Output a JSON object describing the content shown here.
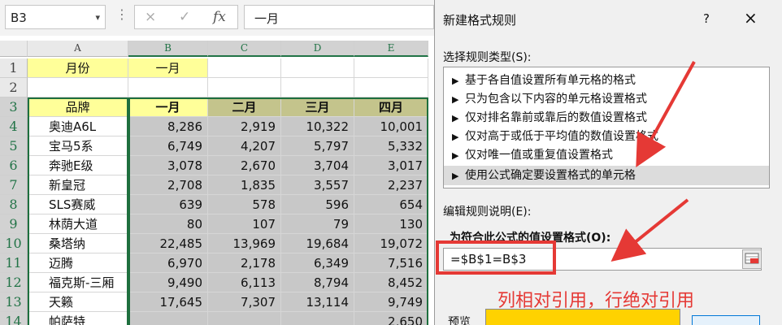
{
  "formula_bar": {
    "name_box": "B3",
    "cancel_icon": "×",
    "enter_icon": "✓",
    "fx_label": "fx",
    "formula": "一月"
  },
  "sheet": {
    "columns": [
      "A",
      "B",
      "C",
      "D",
      "E"
    ],
    "row_numbers": [
      "1",
      "2",
      "3",
      "4",
      "5",
      "6",
      "7",
      "8",
      "9",
      "10",
      "11",
      "12",
      "13",
      "14"
    ],
    "row1": {
      "a": "月份",
      "b": "一月"
    },
    "headers": [
      "品牌",
      "一月",
      "二月",
      "三月",
      "四月"
    ],
    "rows": [
      [
        "奥迪A6L",
        "8,286",
        "2,919",
        "10,322",
        "10,001"
      ],
      [
        "宝马5系",
        "6,749",
        "4,207",
        "5,797",
        "5,332"
      ],
      [
        "奔驰E级",
        "3,078",
        "2,670",
        "3,704",
        "3,017"
      ],
      [
        "新皇冠",
        "2,708",
        "1,835",
        "3,557",
        "2,237"
      ],
      [
        "SLS赛威",
        "639",
        "578",
        "596",
        "654"
      ],
      [
        "林荫大道",
        "80",
        "107",
        "79",
        "130"
      ],
      [
        "桑塔纳",
        "22,485",
        "13,969",
        "19,684",
        "19,072"
      ],
      [
        "迈腾",
        "6,970",
        "2,178",
        "6,349",
        "7,516"
      ],
      [
        "福克斯-三厢",
        "9,490",
        "6,113",
        "8,794",
        "8,452"
      ],
      [
        "天籁",
        "17,645",
        "7,307",
        "13,114",
        "9,749"
      ],
      [
        "帕萨特",
        "",
        "",
        "",
        "2,650"
      ]
    ]
  },
  "dialog": {
    "title": "新建格式规则",
    "help": "?",
    "close": "×",
    "rule_type_label": "选择规则类型(S):",
    "rule_types": [
      "基于各自值设置所有单元格的格式",
      "只为包含以下内容的单元格设置格式",
      "仅对排名靠前或靠后的数值设置格式",
      "仅对高于或低于平均值的数值设置格式",
      "仅对唯一值或重复值设置格式",
      "使用公式确定要设置格式的单元格"
    ],
    "edit_label": "编辑规则说明(E):",
    "formula_label": "为符合此公式的值设置格式(O):",
    "formula_value": "=$B$1=B$3",
    "preview_label": "预览"
  },
  "annotation": {
    "text": "列相对引用，行绝对引用",
    "color": "#e53935"
  }
}
